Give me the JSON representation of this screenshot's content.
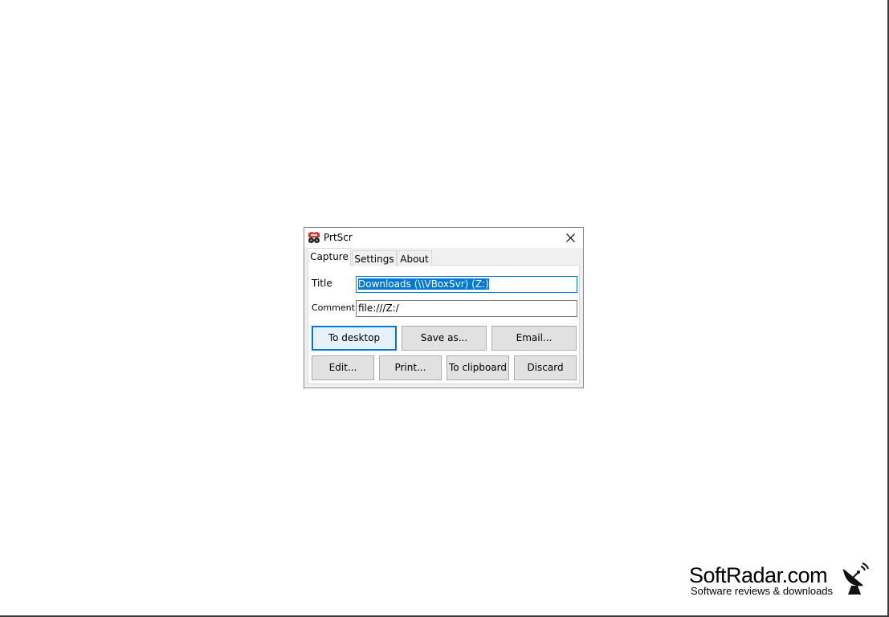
{
  "window": {
    "title": "PrtScr",
    "icon": "camera-app-icon",
    "close_icon": "close-icon"
  },
  "tabs": [
    {
      "label": "Capture",
      "active": true
    },
    {
      "label": "Settings",
      "active": false
    },
    {
      "label": "About",
      "active": false
    }
  ],
  "form": {
    "title_label": "Title",
    "title_value": "Downloads (\\\\VBoxSvr) (Z:)",
    "comment_label": "Comment",
    "comment_value": "file:///Z:/"
  },
  "buttons": {
    "to_desktop": "To desktop",
    "save_as": "Save as...",
    "email": "Email...",
    "edit": "Edit...",
    "print": "Print...",
    "to_clipboard": "To clipboard",
    "discard": "Discard"
  },
  "watermark": {
    "name": "SoftRadar.com",
    "tagline": "Software reviews & downloads",
    "icon": "satellite-dish-icon"
  },
  "colors": {
    "accent": "#0078d7",
    "button_face": "#e1e1e1",
    "dialog_bg": "#f0f0f0"
  }
}
